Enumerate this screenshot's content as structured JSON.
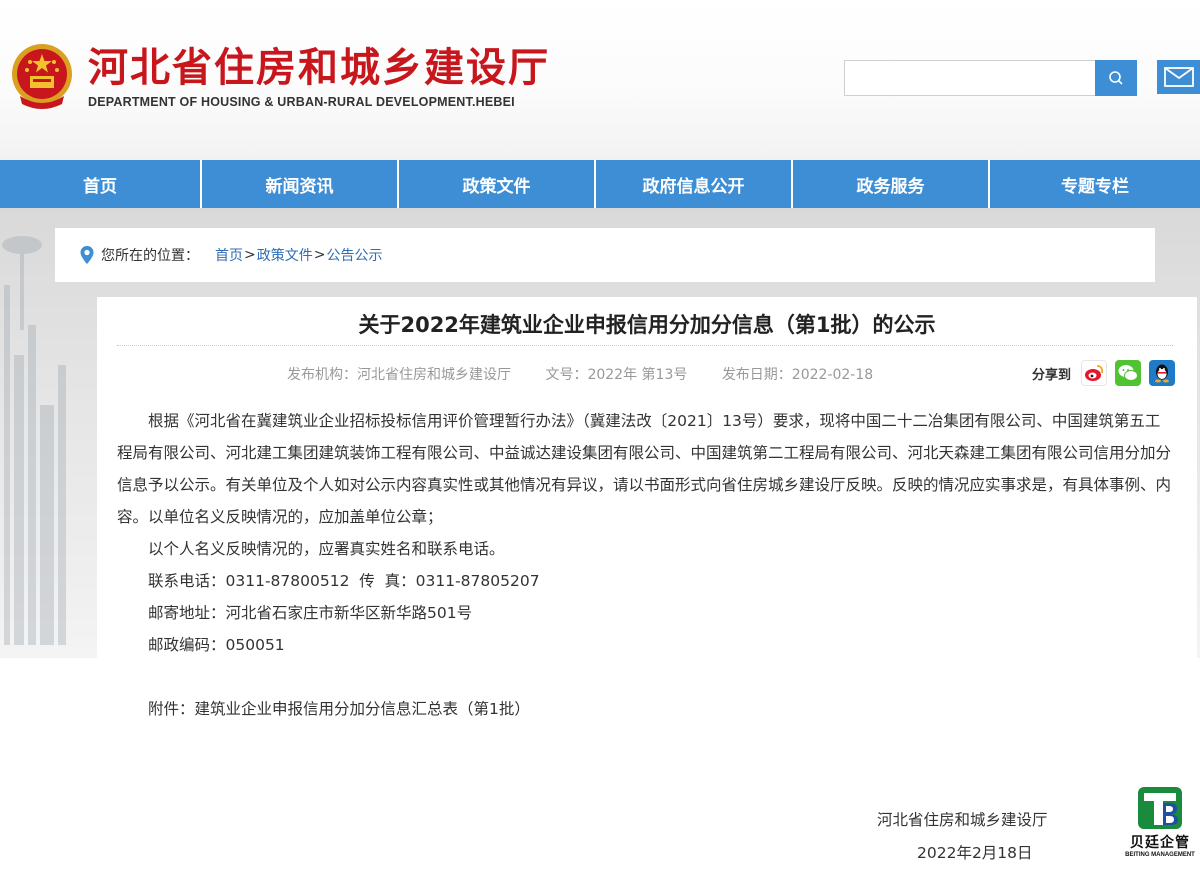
{
  "header": {
    "title": "河北省住房和城乡建设厅",
    "subtitle": "DEPARTMENT OF HOUSING & URBAN-RURAL DEVELOPMENT.HEBEI",
    "search": {
      "value": "",
      "placeholder": ""
    }
  },
  "nav": {
    "items": [
      "首页",
      "新闻资讯",
      "政策文件",
      "政府信息公开",
      "政务服务",
      "专题专栏"
    ]
  },
  "breadcrumb": {
    "label": "您所在的位置：",
    "items": [
      "首页",
      "政策文件",
      "公告公示"
    ],
    "separator": ">"
  },
  "article": {
    "title": "关于2022年建筑业企业申报信用分加分信息（第1批）的公示",
    "meta": {
      "publisher": "发布机构：河北省住房和城乡建设厅",
      "doc_no": "文号：2022年 第13号",
      "date": "发布日期：2022-02-18"
    },
    "share_label": "分享到",
    "share_icons": [
      "weibo-icon",
      "wechat-icon",
      "qq-icon"
    ],
    "paragraph1": "根据《河北省在冀建筑业企业招标投标信用评价管理暂行办法》（冀建法改〔2021〕13号）要求，现将中国二十二冶集团有限公司、中国建筑第五工程局有限公司、河北建工集团建筑装饰工程有限公司、中益诚达建设集团有限公司、中国建筑第二工程局有限公司、河北天森建工集团有限公司信用分加分信息予以公示。有关单位及个人如对公示内容真实性或其他情况有异议，请以书面形式向省住房城乡建设厅反映。反映的情况应实事求是，有具体事例、内容。以单位名义反映情况的，应加盖单位公章；",
    "line2": "以个人名义反映情况的，应署真实姓名和联系电话。",
    "contact": "联系电话：0311-87800512  传  真：0311-87805207",
    "address": "邮寄地址：河北省石家庄市新华区新华路501号",
    "postcode": "邮政编码：050051",
    "attachment_prefix": "附件：",
    "attachment": "建筑业企业申报信用分加分信息汇总表（第1批）",
    "sign_org": "河北省住房和城乡建设厅",
    "sign_date": "2022年2月18日"
  },
  "watermark": {
    "name": "贝廷企管",
    "en": "BEITING MANAGEMENT"
  },
  "colors": {
    "brand_red": "#c8161d",
    "nav_blue": "#3e8ed6",
    "link_blue": "#2f6db5"
  }
}
